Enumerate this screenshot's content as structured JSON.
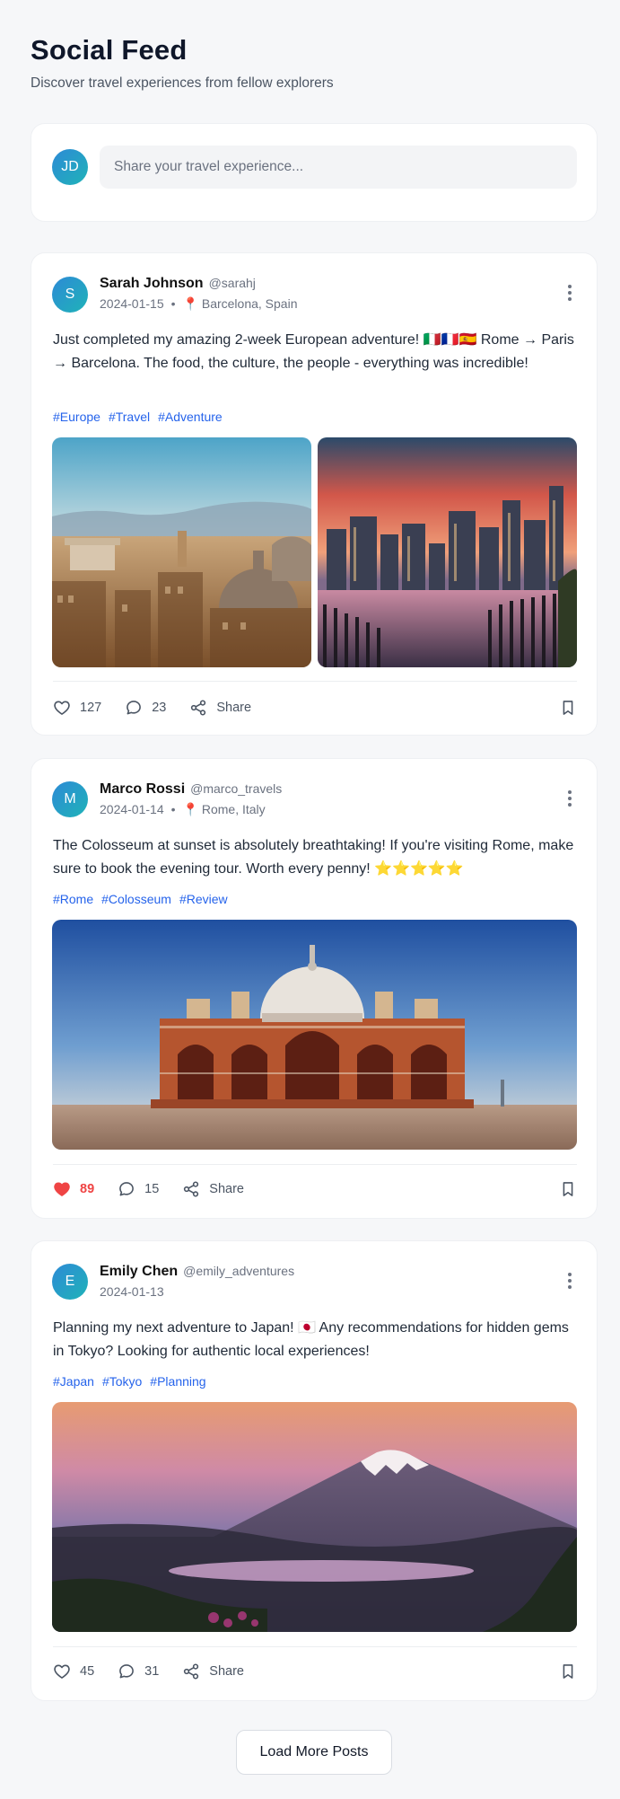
{
  "header": {
    "title": "Social Feed",
    "subtitle": "Discover travel experiences from fellow explorers"
  },
  "composer": {
    "avatar_initials": "JD",
    "placeholder": "Share your travel experience..."
  },
  "posts": [
    {
      "initial": "S",
      "name": "Sarah Johnson",
      "handle": "@sarahj",
      "date": "2024-01-15",
      "location": "📍 Barcelona, Spain",
      "text": "Just completed my amazing 2-week European adventure! 🇮🇹🇫🇷🇪🇸 Rome → Paris → Barcelona. The food, the culture, the people - everything was incredible!",
      "tags": [
        "#Europe",
        "#Travel",
        "#Adventure"
      ],
      "images": [
        "rome-cityscape",
        "city-skyline-sunset"
      ],
      "likes": "127",
      "comments": "23",
      "share_label": "Share",
      "liked": false
    },
    {
      "initial": "M",
      "name": "Marco Rossi",
      "handle": "@marco_travels",
      "date": "2024-01-14",
      "location": "📍 Rome, Italy",
      "text": "The Colosseum at sunset is absolutely breathtaking! If you're visiting Rome, make sure to book the evening tour. Worth every penny! ⭐⭐⭐⭐⭐",
      "tags": [
        "#Rome",
        "#Colosseum",
        "#Review"
      ],
      "images": [
        "domed-monument"
      ],
      "likes": "89",
      "comments": "15",
      "share_label": "Share",
      "liked": true
    },
    {
      "initial": "E",
      "name": "Emily Chen",
      "handle": "@emily_adventures",
      "date": "2024-01-13",
      "location": "",
      "text": "Planning my next adventure to Japan! 🇯🇵 Any recommendations for hidden gems in Tokyo? Looking for authentic local experiences!",
      "tags": [
        "#Japan",
        "#Tokyo",
        "#Planning"
      ],
      "images": [
        "mount-fuji-lake"
      ],
      "likes": "45",
      "comments": "31",
      "share_label": "Share",
      "liked": false
    }
  ],
  "load_more_label": "Load More Posts",
  "colors": {
    "accent": "#2563eb",
    "like_active": "#ef4444",
    "avatar_gradient_start": "#2d8ad6",
    "avatar_gradient_end": "#1fb3b8"
  }
}
